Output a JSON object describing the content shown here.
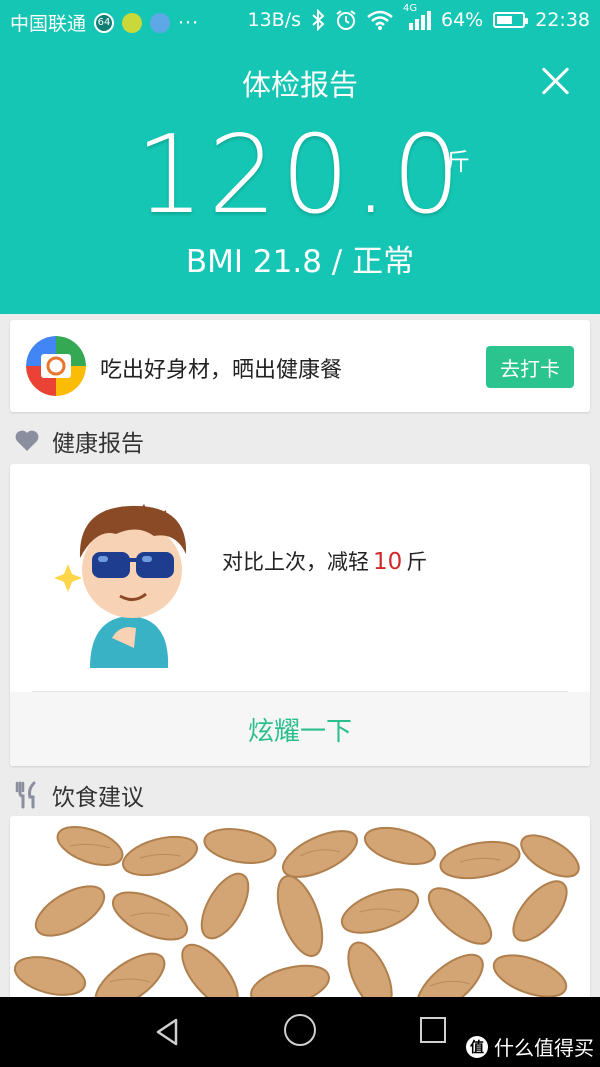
{
  "status_bar": {
    "carrier": "中国联通",
    "badge": "64",
    "dots": "···",
    "net_speed": "13B/s",
    "network": "4G",
    "battery_percent": "64%",
    "battery_level": 0.64,
    "time": "22:38"
  },
  "header": {
    "title": "体检报告",
    "weight": "120.0",
    "unit": "斤",
    "bmi_line": "BMI 21.8 / 正常",
    "bg_color": "#14c6b3"
  },
  "promo": {
    "text": "吃出好身材，晒出健康餐",
    "button_label": "去打卡",
    "button_color": "#2bc48f"
  },
  "health_report": {
    "section_title": "健康报告",
    "text_before": "对比上次，减轻",
    "number": "10",
    "text_after": "斤",
    "share_label": "炫耀一下"
  },
  "diet": {
    "section_title": "饮食建议"
  },
  "watermark": {
    "logo": "值",
    "text": "什么值得买"
  },
  "icons": {
    "heart": "heart-icon",
    "fork_knife": "fork-knife-icon",
    "close": "close-icon"
  }
}
